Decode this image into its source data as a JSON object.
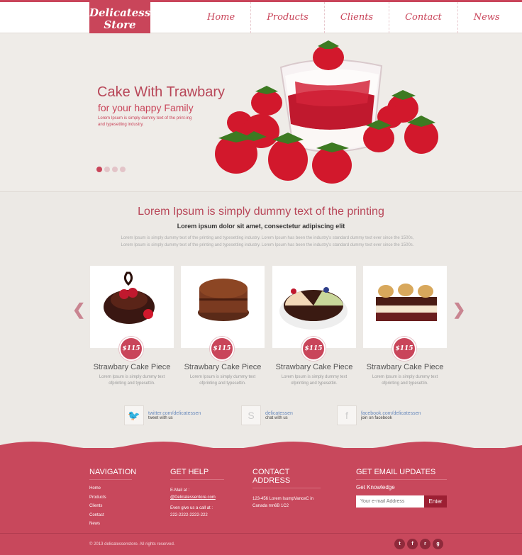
{
  "header": {
    "logo_line1": "Delicatessen",
    "logo_line2": "Store",
    "nav": [
      "Home",
      "Products",
      "Clients",
      "Contact",
      "News"
    ]
  },
  "hero": {
    "title": "Cake With Trawbary",
    "subtitle": "for your happy Family",
    "text": "Lorem Ipsum is simply dummy text of the print-ing and typesetting industry."
  },
  "intro": {
    "title": "Lorem Ipsum is simply dummy text of the printing",
    "subtitle": "Lorem ipsum dolor sit amet, consectetur adipiscing elit",
    "text": "Lorem Ipsum is simply dummy text of the printing and typesetting industry. Lorem Ipsum has been the industry's standard dummy text ever since the 1500s, Lorem Ipsum is simply dummy text of the printing and typesetting industry. Lorem Ipsum has been the industry's standard dummy text ever since the 1500s."
  },
  "products": [
    {
      "title": "Strawbary Cake Piece",
      "price": "$115",
      "text": "Lorem Ipsum is simply dummy text ofprinting and typesettin."
    },
    {
      "title": "Strawbary Cake Piece",
      "price": "$115",
      "text": "Lorem Ipsum is simply dummy text ofprinting and typesettin."
    },
    {
      "title": "Strawbary Cake Piece",
      "price": "$115",
      "text": "Lorem Ipsum is simply dummy text ofprinting and typesettin."
    },
    {
      "title": "Strawbary Cake Piece",
      "price": "$115",
      "text": "Lorem Ipsum is simply dummy text ofprinting and typesettin."
    }
  ],
  "social": [
    {
      "link": "twitter.com/delicatessen",
      "sub": "tweet with us",
      "icon": "twitter-icon"
    },
    {
      "link": "delicatessen",
      "sub": "chat with us",
      "icon": "skype-icon"
    },
    {
      "link": "facebook.com/delicatessen",
      "sub": "join on facebook",
      "icon": "facebook-icon"
    }
  ],
  "footer": {
    "nav_heading": "NAVIGATION",
    "nav_links": [
      "Home",
      "Products",
      "Clients",
      "Contact",
      "News"
    ],
    "help_heading": "GET HELP",
    "help_email_label": "E-Mail at :",
    "help_email": "@Delicatessentore.com",
    "help_call_label": "Even give us a call at :",
    "help_phone": "222-2222-2222-222",
    "address_heading": "CONTACT ADDRESS",
    "address_text": "123-456 Lorem IsumpVanceC in Canada mn6B 1C2",
    "updates_heading": "GET EMAIL UPDATES",
    "updates_sub": "Get Knowledge",
    "email_placeholder": "Your e-mail Address",
    "enter_label": "Enter",
    "copyright": "© 2013 delicatessenstore. All rights reserved."
  },
  "colors": {
    "accent": "#c9455a",
    "background": "#ece9e5",
    "footer": "#c8485c"
  }
}
